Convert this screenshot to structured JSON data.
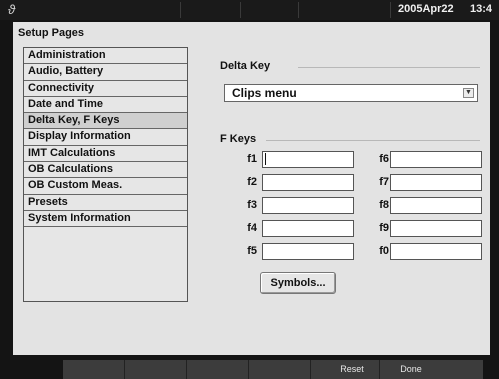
{
  "status_bar": {
    "logo_icon": "wave-logo-icon",
    "date": "2005Apr22",
    "time": "13:4"
  },
  "setup": {
    "title": "Setup Pages",
    "pages": [
      "Administration",
      "Audio, Battery",
      "Connectivity",
      "Date and Time",
      "Delta Key, F Keys",
      "Display Information",
      "IMT Calculations",
      "OB Calculations",
      "OB Custom Meas.",
      "Presets",
      "System Information"
    ],
    "selected_page": "Delta Key, F Keys"
  },
  "delta_key": {
    "heading": "Delta Key",
    "selected_value": "Clips menu"
  },
  "f_keys": {
    "heading": "F Keys",
    "keys": [
      {
        "label": "f1",
        "value": ""
      },
      {
        "label": "f2",
        "value": ""
      },
      {
        "label": "f3",
        "value": ""
      },
      {
        "label": "f4",
        "value": ""
      },
      {
        "label": "f5",
        "value": ""
      },
      {
        "label": "f6",
        "value": ""
      },
      {
        "label": "f7",
        "value": ""
      },
      {
        "label": "f8",
        "value": ""
      },
      {
        "label": "f9",
        "value": ""
      },
      {
        "label": "f0",
        "value": ""
      }
    ],
    "symbols_button": "Symbols..."
  },
  "soft_keys": [
    "",
    "",
    "",
    "",
    "Reset",
    "Done"
  ]
}
